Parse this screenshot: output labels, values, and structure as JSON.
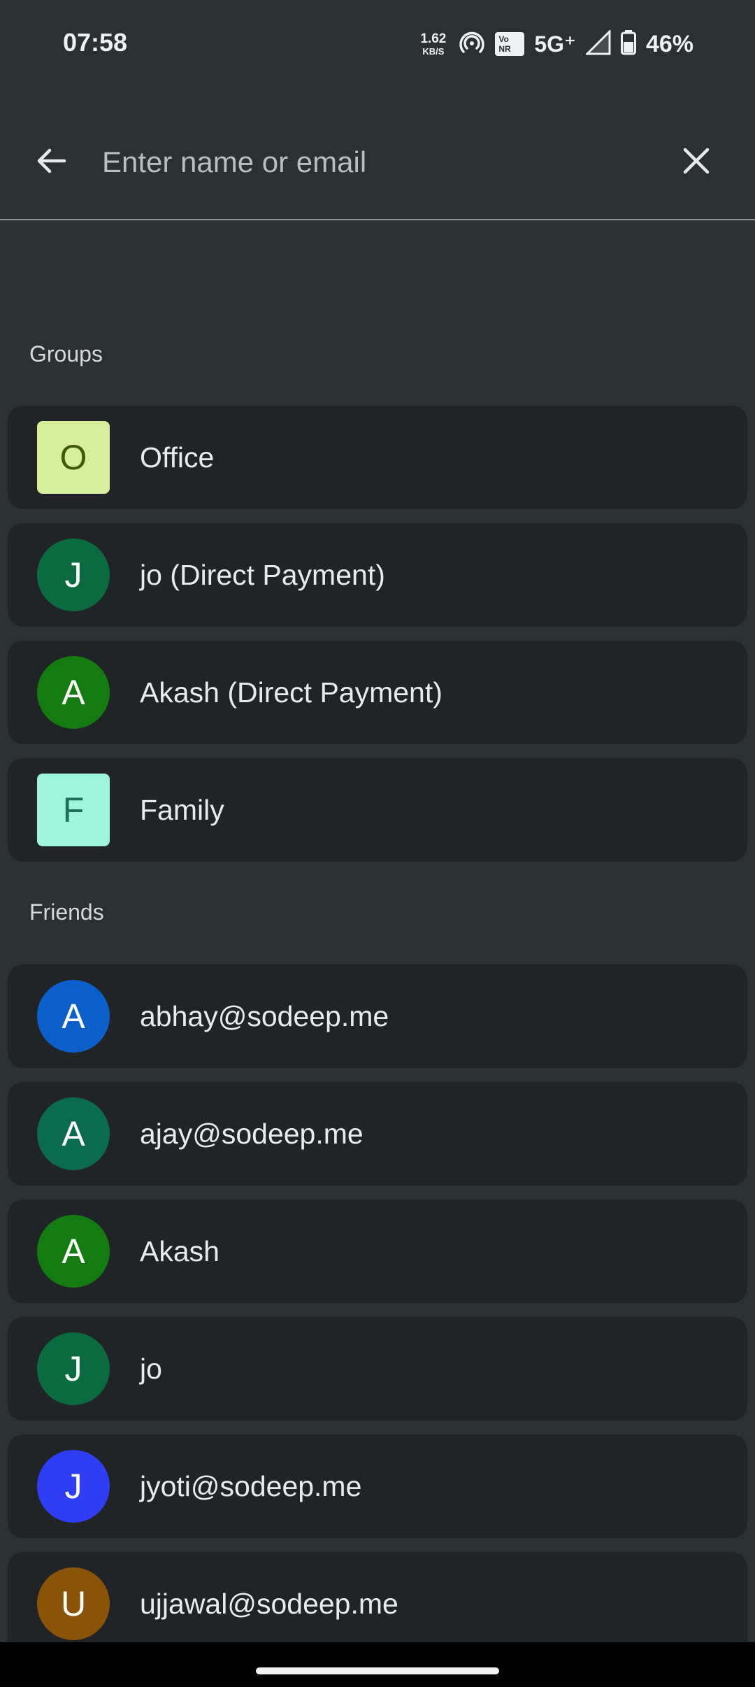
{
  "status_bar": {
    "time": "07:58",
    "net_speed_value": "1.62",
    "net_speed_unit": "KB/S",
    "vonr_top": "Vo",
    "vonr_bottom": "NR",
    "network": "5G⁺",
    "battery": "46%",
    "icons": [
      "hotspot-icon",
      "vonr-icon",
      "signal-icon",
      "battery-icon"
    ]
  },
  "search": {
    "placeholder": "Enter name or email",
    "value": ""
  },
  "groups": {
    "heading": "Groups",
    "items": [
      {
        "initial": "O",
        "label": "Office",
        "shape": "square",
        "bg": "#d7ef9a",
        "fg": "#3e5a0c"
      },
      {
        "initial": "J",
        "label": "jo (Direct Payment)",
        "shape": "circle",
        "bg": "#0b6b40",
        "fg": "#ffffff"
      },
      {
        "initial": "A",
        "label": "Akash (Direct Payment)",
        "shape": "circle",
        "bg": "#127c10",
        "fg": "#ffffff"
      },
      {
        "initial": "F",
        "label": "Family",
        "shape": "square",
        "bg": "#9ff4dc",
        "fg": "#1f6f5c"
      }
    ]
  },
  "friends": {
    "heading": "Friends",
    "items": [
      {
        "initial": "A",
        "label": "abhay@sodeep.me",
        "shape": "circle",
        "bg": "#0a5fcb",
        "fg": "#ffffff"
      },
      {
        "initial": "A",
        "label": "ajay@sodeep.me",
        "shape": "circle",
        "bg": "#0b6b4f",
        "fg": "#ffffff"
      },
      {
        "initial": "A",
        "label": "Akash",
        "shape": "circle",
        "bg": "#127c10",
        "fg": "#ffffff"
      },
      {
        "initial": "J",
        "label": "jo",
        "shape": "circle",
        "bg": "#0b6b40",
        "fg": "#ffffff"
      },
      {
        "initial": "J",
        "label": "jyoti@sodeep.me",
        "shape": "circle",
        "bg": "#2f3df5",
        "fg": "#ffffff"
      },
      {
        "initial": "U",
        "label": "ujjawal@sodeep.me",
        "shape": "circle",
        "bg": "#8a5308",
        "fg": "#ffffff"
      }
    ]
  }
}
